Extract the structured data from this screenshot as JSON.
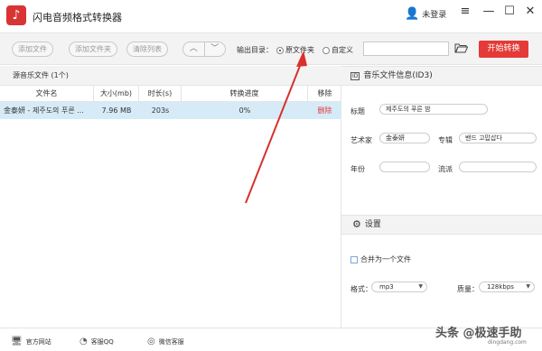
{
  "app": {
    "title": "闪电音频格式转换器",
    "logo_glyph": "♪",
    "login": "未登录"
  },
  "window": {
    "menu_glyph": "≡",
    "min_glyph": "—",
    "max_glyph": "☐",
    "close_glyph": "✕"
  },
  "toolbar": {
    "add_file": "添加文件",
    "add_folder": "添加文件夹",
    "clear_list": "清除列表",
    "up_glyph": "︿",
    "down_glyph": "﹀",
    "output_label": "输出目录：",
    "opt_source": "原文件夹",
    "opt_custom": "自定义",
    "path_value": "",
    "start": "开始转换"
  },
  "list": {
    "header": "源音乐文件 (1个)",
    "columns": [
      "文件名",
      "大小(mb)",
      "时长(s)",
      "转换进度",
      "移除"
    ],
    "rows": [
      {
        "name": "金泰妍 - 제주도의 푸른 ...",
        "size": "7.96 MB",
        "duration": "203s",
        "progress": "0%",
        "remove": "删除"
      }
    ]
  },
  "id3": {
    "header": "音乐文件信息(ID3)",
    "badge": "ID",
    "title_label": "标题",
    "title_value": "제주도의 푸른 밤",
    "artist_label": "艺术家",
    "artist_value": "金泰妍",
    "album_label": "专辑",
    "album_value": "밴드 고맙삽다",
    "year_label": "年份",
    "year_value": "",
    "genre_label": "流派",
    "genre_value": ""
  },
  "settings": {
    "header": "设置",
    "merge_label": "合并为一个文件",
    "format_label": "格式：",
    "format_value": "mp3",
    "quality_label": "质量：",
    "quality_value": "128kbps"
  },
  "footer": {
    "website": "官方网站",
    "qq": "客服QQ",
    "wechat": "微信客服"
  },
  "watermark": {
    "main": "头条 @极速手助",
    "sub": "dingdang.com"
  },
  "colors": {
    "accent": "#e53a37",
    "selected_row": "#d6ebf7"
  }
}
